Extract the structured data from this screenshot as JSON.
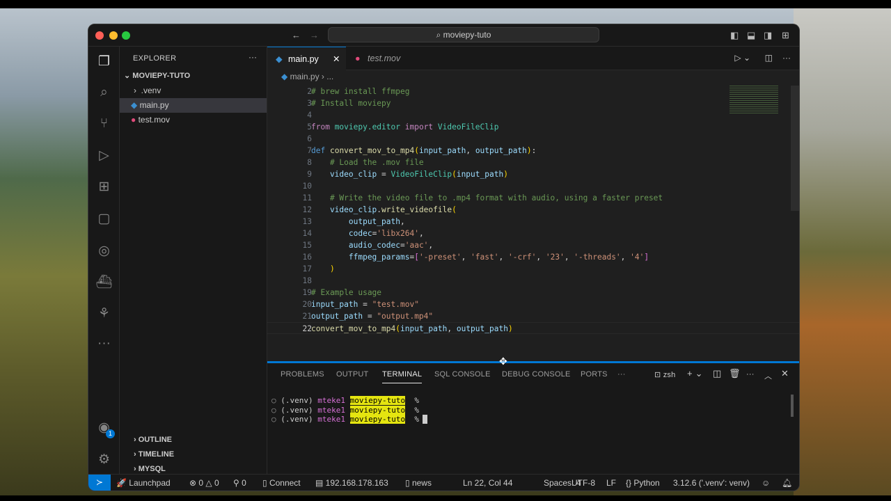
{
  "window": {
    "title": "moviepy-tuto"
  },
  "sidebar": {
    "title": "EXPLORER",
    "root": "MOVIEPY-TUTO",
    "items": [
      {
        "label": ".venv",
        "icon": "chevron-right-icon"
      },
      {
        "label": "main.py",
        "icon": "python-icon"
      },
      {
        "label": "test.mov",
        "icon": "video-file-icon"
      }
    ],
    "sections": [
      "OUTLINE",
      "TIMELINE",
      "MYSQL"
    ],
    "accounts_badge": "1"
  },
  "tabs": [
    {
      "label": "main.py",
      "active": true
    },
    {
      "label": "test.mov",
      "active": false
    }
  ],
  "breadcrumb": {
    "file": "main.py",
    "more": "..."
  },
  "code": [
    {
      "n": "2",
      "t": [
        [
          "# brew install ffmpeg",
          "cm"
        ]
      ]
    },
    {
      "n": "3",
      "t": [
        [
          "# Install moviepy",
          "cm"
        ]
      ]
    },
    {
      "n": "4",
      "t": []
    },
    {
      "n": "5",
      "t": [
        [
          "from",
          "kw2"
        ],
        [
          " moviepy.editor ",
          "cls"
        ],
        [
          "import",
          "kw2"
        ],
        [
          " VideoFileClip",
          "cls"
        ]
      ]
    },
    {
      "n": "6",
      "t": []
    },
    {
      "n": "7",
      "t": [
        [
          "def",
          "kw"
        ],
        [
          " ",
          "pun"
        ],
        [
          "convert_mov_to_mp4",
          "fn"
        ],
        [
          "(",
          "br"
        ],
        [
          "input_path",
          "var"
        ],
        [
          ", ",
          "pun"
        ],
        [
          "output_path",
          "var"
        ],
        [
          ")",
          "br"
        ],
        [
          ":",
          "pun"
        ]
      ]
    },
    {
      "n": "8",
      "t": [
        [
          "    # Load the .mov file",
          "cm"
        ]
      ]
    },
    {
      "n": "9",
      "t": [
        [
          "    video_clip",
          "var"
        ],
        [
          " = ",
          "pun"
        ],
        [
          "VideoFileClip",
          "cls"
        ],
        [
          "(",
          "br"
        ],
        [
          "input_path",
          "var"
        ],
        [
          ")",
          "br"
        ]
      ]
    },
    {
      "n": "10",
      "t": []
    },
    {
      "n": "11",
      "t": [
        [
          "    # Write the video file to .mp4 format with audio, using a faster preset",
          "cm"
        ]
      ]
    },
    {
      "n": "12",
      "t": [
        [
          "    video_clip",
          "var"
        ],
        [
          ".",
          "pun"
        ],
        [
          "write_videofile",
          "fn"
        ],
        [
          "(",
          "br"
        ]
      ]
    },
    {
      "n": "13",
      "t": [
        [
          "        output_path",
          "var"
        ],
        [
          ",",
          "pun"
        ]
      ]
    },
    {
      "n": "14",
      "t": [
        [
          "        codec",
          "var"
        ],
        [
          "=",
          "pun"
        ],
        [
          "'libx264'",
          "str"
        ],
        [
          ",",
          "pun"
        ]
      ]
    },
    {
      "n": "15",
      "t": [
        [
          "        audio_codec",
          "var"
        ],
        [
          "=",
          "pun"
        ],
        [
          "'aac'",
          "str"
        ],
        [
          ",",
          "pun"
        ]
      ]
    },
    {
      "n": "16",
      "t": [
        [
          "        ffmpeg_params",
          "var"
        ],
        [
          "=",
          "pun"
        ],
        [
          "[",
          "br2"
        ],
        [
          "'-preset'",
          "str"
        ],
        [
          ", ",
          "pun"
        ],
        [
          "'fast'",
          "str"
        ],
        [
          ", ",
          "pun"
        ],
        [
          "'-crf'",
          "str"
        ],
        [
          ", ",
          "pun"
        ],
        [
          "'23'",
          "str"
        ],
        [
          ", ",
          "pun"
        ],
        [
          "'-threads'",
          "str"
        ],
        [
          ", ",
          "pun"
        ],
        [
          "'4'",
          "str"
        ],
        [
          "]",
          "br2"
        ]
      ]
    },
    {
      "n": "17",
      "t": [
        [
          "    )",
          "br"
        ]
      ]
    },
    {
      "n": "18",
      "t": []
    },
    {
      "n": "19",
      "t": [
        [
          "# Example usage",
          "cm"
        ]
      ]
    },
    {
      "n": "20",
      "t": [
        [
          "input_path",
          "var"
        ],
        [
          " = ",
          "pun"
        ],
        [
          "\"test.mov\"",
          "str"
        ]
      ]
    },
    {
      "n": "21",
      "t": [
        [
          "output_path",
          "var"
        ],
        [
          " = ",
          "pun"
        ],
        [
          "\"output.mp4\"",
          "str"
        ]
      ]
    },
    {
      "n": "22",
      "t": [
        [
          "convert_mov_to_mp4",
          "fn"
        ],
        [
          "(",
          "br"
        ],
        [
          "input_path",
          "var"
        ],
        [
          ", ",
          "pun"
        ],
        [
          "output_path",
          "var"
        ],
        [
          ")",
          "br"
        ]
      ]
    }
  ],
  "panel": {
    "tabs": [
      "PROBLEMS",
      "OUTPUT",
      "TERMINAL",
      "SQL CONSOLE",
      "DEBUG CONSOLE",
      "PORTS",
      "···"
    ],
    "shell": "zsh",
    "terminal": [
      {
        "env": "(.venv)",
        "user": "mteke1",
        "dir": "moviepy-tuto",
        "prompt": "%"
      },
      {
        "env": "(.venv)",
        "user": "mteke1",
        "dir": "moviepy-tuto",
        "prompt": "%"
      },
      {
        "env": "(.venv)",
        "user": "mteke1",
        "dir": "moviepy-tuto",
        "prompt": "%"
      }
    ]
  },
  "status": {
    "launchpad": "Launchpad",
    "errors": "0",
    "warnings": "0",
    "ports": "0",
    "connect": "Connect",
    "host": "192.168.178.163",
    "db": "news",
    "position": "Ln 22, Col 44",
    "spaces": "Spaces: 4",
    "encoding": "UTF-8",
    "eol": "LF",
    "language": "Python",
    "interpreter": "3.12.6 ('.venv': venv)"
  }
}
